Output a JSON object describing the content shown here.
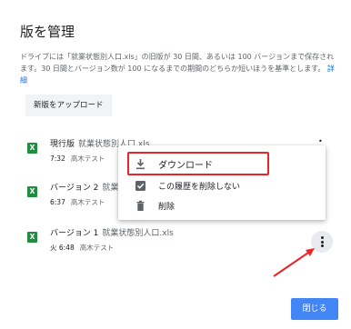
{
  "dialog": {
    "title": "版を管理",
    "description": "ドライブには「就業状態別人口.xls」の旧版が 30 日間、あるいは 100 バージョンまで保存されます。30 日間とバージョン数が 100 になるまでの期間のどちらか短いほうを基準とします。",
    "details_link": "詳細",
    "upload_button": "新版をアップロード",
    "close_button": "閉じる"
  },
  "versions": [
    {
      "icon": "xls-file-icon",
      "icon_letter": "X",
      "label": "現行版",
      "filename": "就業状態別人口.xls",
      "time": "7:32",
      "user": "高木テスト"
    },
    {
      "icon": "xls-file-icon",
      "icon_letter": "X",
      "label": "バージョン 2",
      "filename": "就業状態別人口.xls",
      "time": "6:37",
      "user": "高木テスト"
    },
    {
      "icon": "xls-file-icon",
      "icon_letter": "X",
      "label": "バージョン 1",
      "filename": "就業状態別人口.xls",
      "time": "火 6:48",
      "user": "高木テスト"
    }
  ],
  "menu": {
    "items": [
      {
        "icon": "download-icon",
        "label": "ダウンロード"
      },
      {
        "icon": "checkbox-checked-icon",
        "label": "この履歴を削除しない"
      },
      {
        "icon": "trash-icon",
        "label": "削除"
      }
    ]
  },
  "colors": {
    "accent": "#4285f4",
    "highlight": "#e8252b",
    "xls_green": "#1e8e3e",
    "link": "#1a73e8"
  }
}
